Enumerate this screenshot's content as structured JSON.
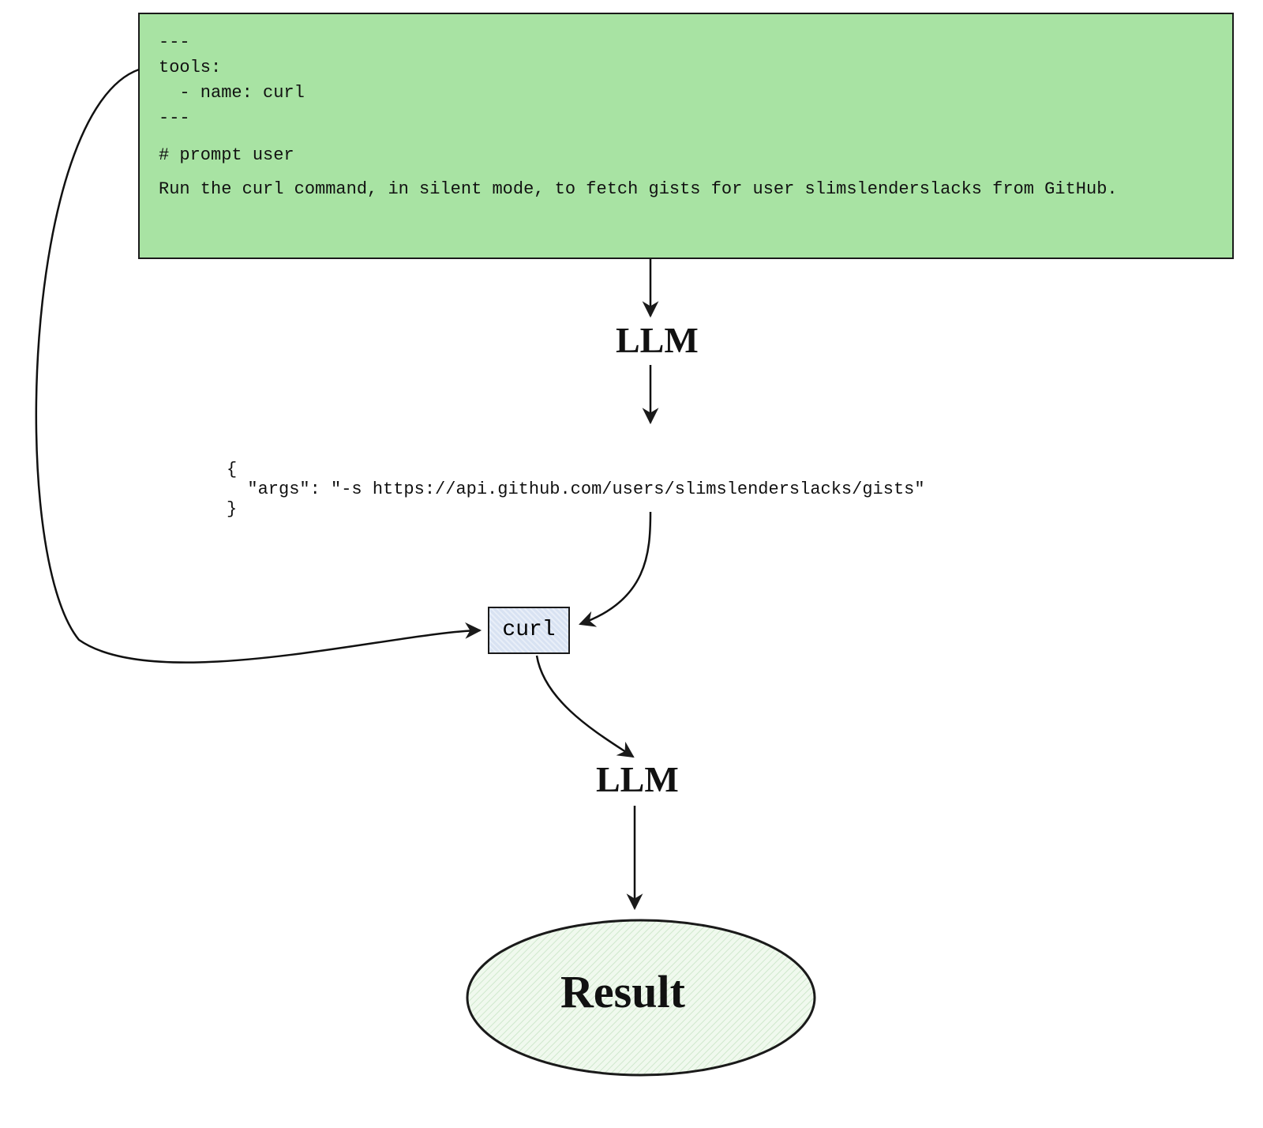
{
  "prompt": {
    "yaml": "---\ntools:\n  - name: curl\n---",
    "heading": "# prompt user",
    "body": "Run the curl command, in silent mode, to fetch gists for user slimslenderslacks from GitHub."
  },
  "labels": {
    "llm1": "LLM",
    "llm2": "LLM",
    "curl_box": "curl",
    "result": "Result"
  },
  "args_json": "{\n  \"args\": \"-s https://api.github.com/users/slimslenderslacks/gists\"\n}",
  "colors": {
    "prompt_bg": "#a8e3a3",
    "curl_bg": "#e8eef8",
    "result_fill": "#e8f5e6"
  }
}
